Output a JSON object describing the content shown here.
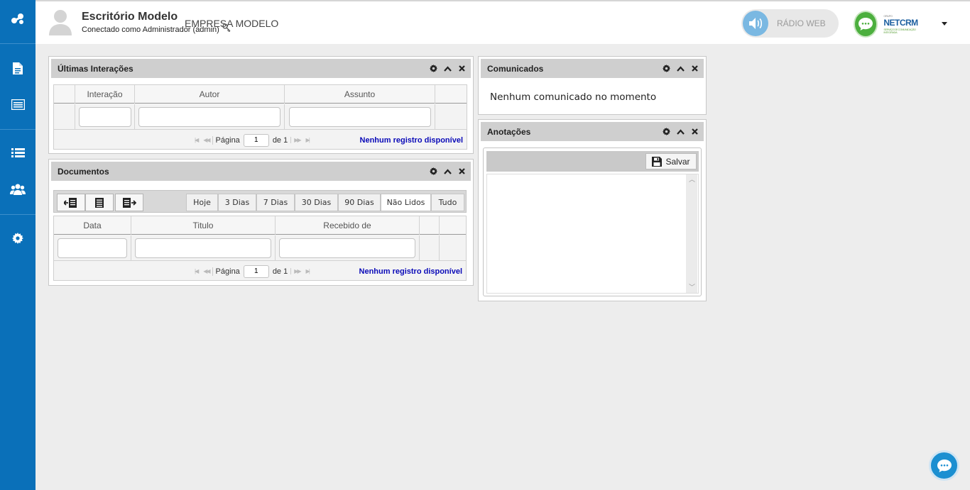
{
  "header": {
    "title": "Escritório Modelo",
    "subtitle": "Conectado como Administrador (admin)",
    "company": "EMPRESA MODELO",
    "radio_label": "RÁDIO WEB",
    "brand_name": "NETCRM",
    "brand_tagline": "SERVIÇO DE COMUNICAÇÃO INTEGRADA",
    "brand_top": "GRUPO"
  },
  "sidebar": {
    "icons": [
      "logo-icon",
      "document-icon",
      "list-card-icon",
      "list-icon",
      "users-icon",
      "gear-icon"
    ]
  },
  "interacoes": {
    "title": "Últimas Interações",
    "columns": [
      "Interação",
      "Autor",
      "Assunto"
    ],
    "page_label": "Página",
    "page_value": "1",
    "of_label": "de 1",
    "status": "Nenhum registro disponível"
  },
  "documentos": {
    "title": "Documentos",
    "filters": [
      "Hoje",
      "3 Dias",
      "7 Dias",
      "30 Dias",
      "90 Dias",
      "Não Lidos",
      "Tudo"
    ],
    "active_filter": "Não Lidos",
    "columns": [
      "Data",
      "Titulo",
      "Recebido de"
    ],
    "page_label": "Página",
    "page_value": "1",
    "of_label": "de 1",
    "status": "Nenhum registro disponível"
  },
  "comunicados": {
    "title": "Comunicados",
    "message": "Nenhum comunicado no momento"
  },
  "anotacoes": {
    "title": "Anotações",
    "save_label": "Salvar",
    "content": ""
  },
  "colors": {
    "sidebar": "#0a70b9",
    "panel_header": "#cfcfcf",
    "status_link": "#0a0ab8",
    "netcrm_green": "#4caf3e"
  }
}
